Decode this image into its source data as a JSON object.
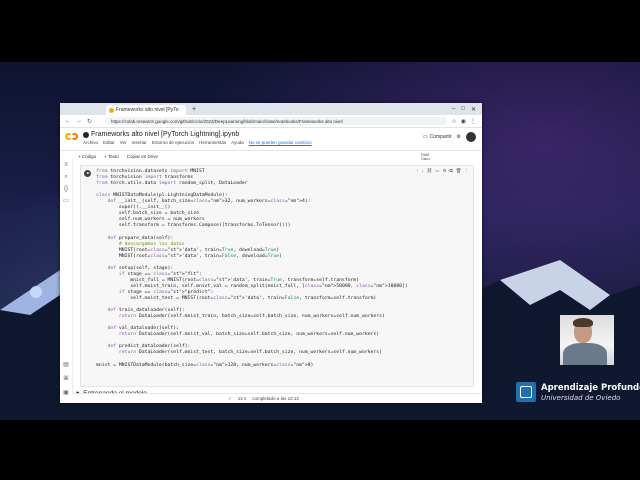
{
  "browser": {
    "tab_title": "Frameworks alto nivel [PyTo",
    "url": "https://colab.research.google.com/github/ciclo/2023/DeepLearning/blob/main/clase/notebooks/Frameworks alto nivel",
    "new_tab": "+",
    "nav_back": "←",
    "nav_forward": "→",
    "nav_reload": "↻"
  },
  "colab": {
    "notebook_title": "Frameworks alto nivel [PyTorch Lightning].ipynb",
    "menus": [
      "Archivo",
      "Editar",
      "Ver",
      "Insertar",
      "Entorno de ejecución",
      "Herramientas",
      "Ayuda"
    ],
    "unsaved_notice": "No se pueden guardar cambios",
    "share_label": "Compartir",
    "add_code": "+ Código",
    "add_text": "+ Texto",
    "copy_drive": "Copiar en Drive",
    "ram_label": "RAM",
    "disk_label": "Disco",
    "section_heading": "Entrenando el modelo",
    "status_time": "12 s",
    "status_text": "completado a las 10:12"
  },
  "code": {
    "lines": [
      "from torchvision.datasets import MNIST",
      "from torchvision import transforms",
      "from torch.utils.data import random_split, DataLoader",
      "",
      "class MNISTDataModule(pl.LightningDataModule):",
      "    def __init__(self, batch_size=32, num_workers=4):",
      "        super().__init__()",
      "        self.batch_size = batch_size",
      "        self.num_workers = num_workers",
      "        self.transform = transforms.Compose([transforms.ToTensor()])",
      "",
      "    def prepare_data(self):",
      "        # descargamos los datos",
      "        MNIST(root='data', train=True, download=True)",
      "        MNIST(root='data', train=False, download=True)",
      "",
      "    def setup(self, stage):",
      "        if stage == \"fit\":",
      "            mnist_full = MNIST(root='data', train=True, transform=self.transform)",
      "            self.mnist_train, self.mnist_val = random_split(mnist_full, [50000, 10000])",
      "        if stage == \"predict\":",
      "            self.mnist_test = MNIST(root='data', train=False, transform=self.transform)",
      "",
      "    def train_dataloader(self):",
      "        return DataLoader(self.mnist_train, batch_size=self.batch_size, num_workers=self.num_workers)",
      "",
      "    def val_dataloader(self):",
      "        return DataLoader(self.mnist_val, batch_size=self.batch_size, num_workers=self.num_workers)",
      "",
      "    def predict_dataloader(self):",
      "        return DataLoader(self.mnist_test, batch_size=self.batch_size, num_workers=self.num_workers)",
      "",
      "mnist = MNISTDataModule(batch_size=128, num_workers=0)"
    ]
  },
  "branding": {
    "line1": "Aprendizaje Profundo",
    "line2": "Universidad de Oviedo"
  },
  "icons": [
    "menu-icon",
    "search-icon",
    "code-icon",
    "folder-icon",
    "gear-icon",
    "comment-icon",
    "run-icon",
    "terminal-icon"
  ]
}
